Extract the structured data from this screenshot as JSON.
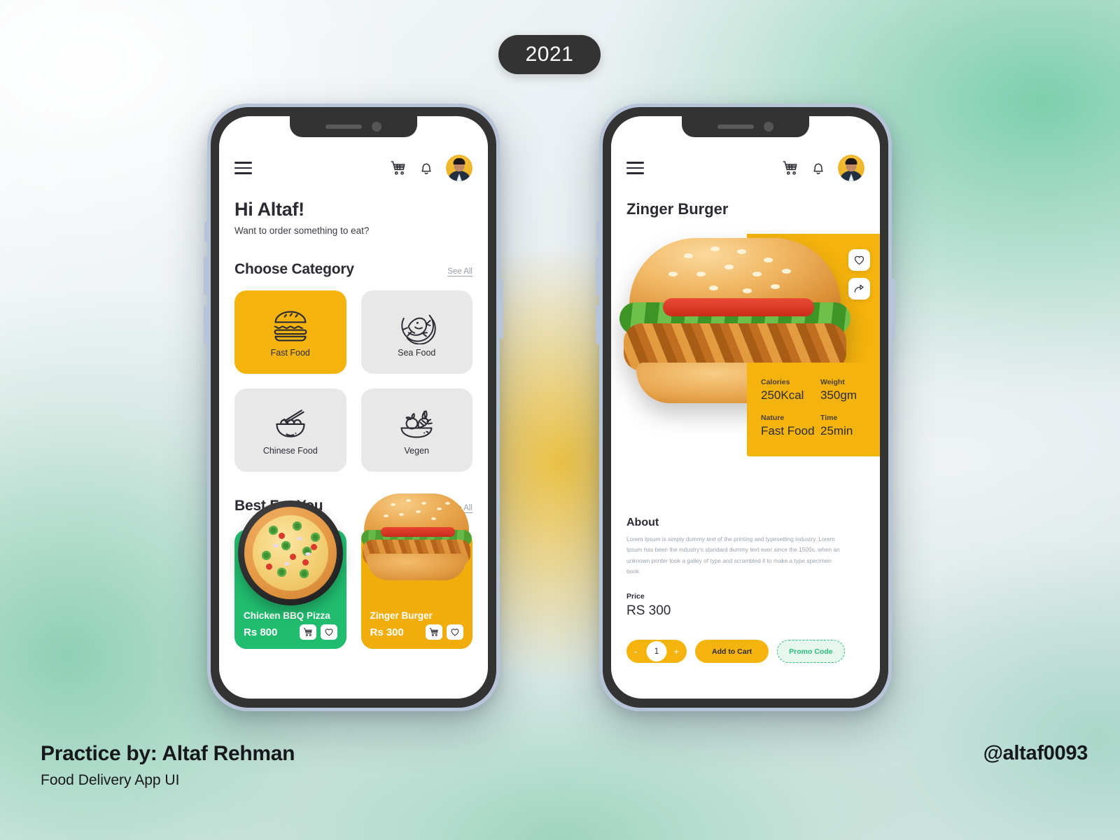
{
  "badge": {
    "year": "2021"
  },
  "footer": {
    "title": "Practice by: Altaf Rehman",
    "subtitle": "Food Delivery App UI",
    "handle": "@altaf0093"
  },
  "home_screen": {
    "appbar": {
      "menu_icon": "hamburger-icon",
      "cart_icon": "cart-icon",
      "bell_icon": "bell-icon",
      "avatar_icon": "user-avatar"
    },
    "greeting": {
      "title": "Hi Altaf!",
      "subtitle": "Want to order something to eat?"
    },
    "category_section": {
      "title": "Choose Category",
      "see_all": "See All",
      "items": [
        {
          "label": "Fast Food",
          "icon": "burger-icon",
          "active": true
        },
        {
          "label": "Sea Food",
          "icon": "fish-icon",
          "active": false
        },
        {
          "label": "Chinese Food",
          "icon": "noodles-icon",
          "active": false
        },
        {
          "label": "Vegen",
          "icon": "veggie-icon",
          "active": false
        }
      ]
    },
    "best_section": {
      "title": "Best For You",
      "see_all": "See All",
      "items": [
        {
          "name": "Chicken BBQ Pizza",
          "price": "Rs 800",
          "color": "#21bd6f"
        },
        {
          "name": "Zinger Burger",
          "price": "Rs 300",
          "color": "#f0ad0c"
        }
      ]
    }
  },
  "detail_screen": {
    "appbar": {
      "menu_icon": "hamburger-icon",
      "cart_icon": "cart-icon",
      "bell_icon": "bell-icon",
      "avatar_icon": "user-avatar"
    },
    "title": "Zinger Burger",
    "hero_actions": [
      {
        "icon": "heart-icon"
      },
      {
        "icon": "share-icon"
      }
    ],
    "nutrition": [
      {
        "key": "Calories",
        "value": "250Kcal"
      },
      {
        "key": "Weight",
        "value": "350gm"
      },
      {
        "key": "Nature",
        "value": "Fast Food"
      },
      {
        "key": "Time",
        "value": "25min"
      }
    ],
    "about": {
      "heading": "About",
      "body": "Lorem Ipsum is simply dummy text of the printing and typesetting industry. Lorem Ipsum has been the industry's standard dummy text ever since the 1500s, when an unknown printer took a galley of type and scrambled it to make a type specimen book"
    },
    "price": {
      "label": "Price",
      "value": "RS 300"
    },
    "actions": {
      "decrement": "-",
      "quantity": "1",
      "increment": "+",
      "add_to_cart": "Add to Cart",
      "promo_code": "Promo Code"
    }
  },
  "colors": {
    "accent_yellow": "#f5b30d",
    "accent_green": "#21bd6f",
    "promo_green": "#2bbd7a",
    "dark": "#2b2b33"
  }
}
